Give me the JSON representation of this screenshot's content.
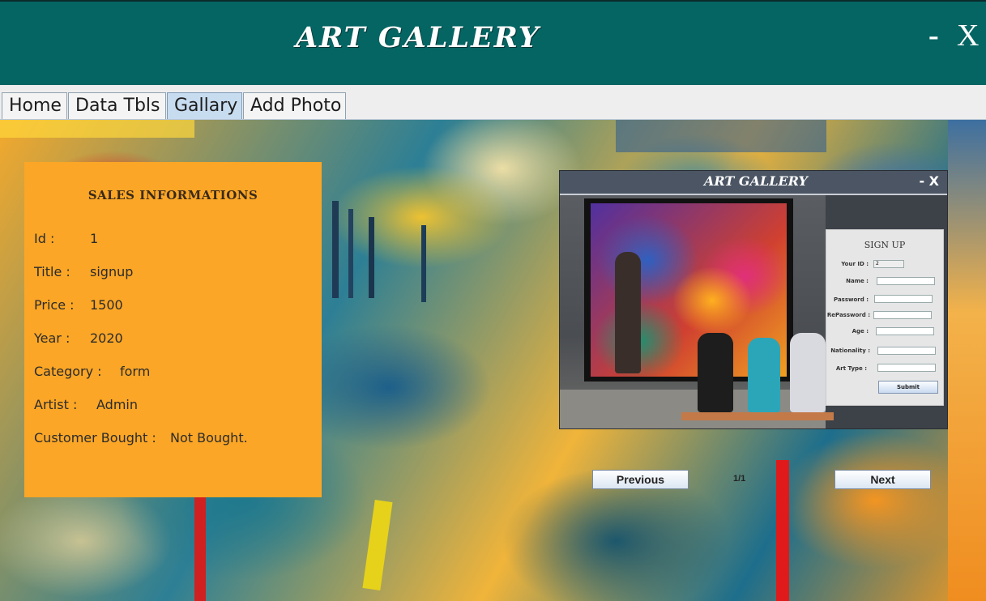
{
  "window": {
    "title": "ART GALLERY",
    "minimize": "-",
    "close": "X"
  },
  "tabs": [
    {
      "label": "Home",
      "active": false
    },
    {
      "label": "Data Tbls",
      "active": false
    },
    {
      "label": "Gallary",
      "active": true
    },
    {
      "label": "Add Photo",
      "active": false
    }
  ],
  "sales": {
    "title": "SALES INFORMATIONS",
    "rows": [
      {
        "label": "Id :",
        "value": "1"
      },
      {
        "label": "Title :",
        "value": "signup"
      },
      {
        "label": "Price :",
        "value": "1500"
      },
      {
        "label": "Year :",
        "value": "2020"
      },
      {
        "label": "Category :",
        "value": "form"
      },
      {
        "label": "Artist :",
        "value": "Admin"
      },
      {
        "label": "Customer Bought :",
        "value": "Not Bought."
      }
    ]
  },
  "preview": {
    "title": "ART GALLERY",
    "winbtns": "- X",
    "form_title": "SIGN UP",
    "fields": [
      {
        "label": "Your ID :",
        "value": "2"
      },
      {
        "label": "Name :",
        "value": ""
      },
      {
        "label": "Password :",
        "value": ""
      },
      {
        "label": "RePassword :",
        "value": ""
      },
      {
        "label": "Age :",
        "value": ""
      },
      {
        "label": "Nationality :",
        "value": ""
      },
      {
        "label": "Art Type :",
        "value": ""
      }
    ],
    "submit": "Submit"
  },
  "navigation": {
    "previous": "Previous",
    "next": "Next",
    "page": "1/1"
  },
  "colors": {
    "header": "#046563",
    "sales_panel": "#fba626",
    "active_tab": "#c8dcf0"
  }
}
